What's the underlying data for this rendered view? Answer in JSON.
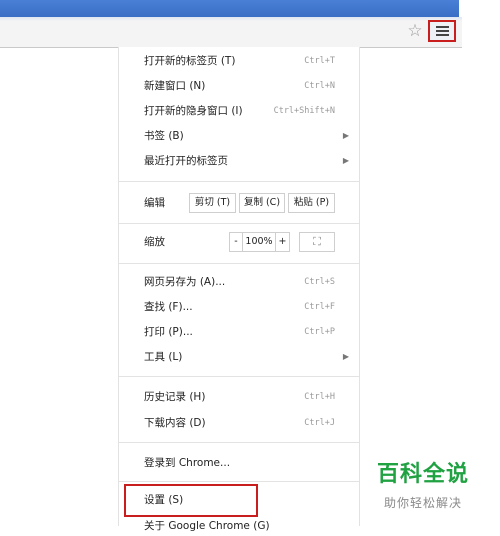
{
  "toolbar": {
    "star_glyph": "☆",
    "star_icon": "star-icon",
    "menu_icon": "menu-icon",
    "highlight_color": "#c81e1e"
  },
  "menu": {
    "new_tab": {
      "label": "打开新的标签页 (T)",
      "shortcut": "Ctrl+T"
    },
    "new_window": {
      "label": "新建窗口 (N)",
      "shortcut": "Ctrl+N"
    },
    "incognito": {
      "label": "打开新的隐身窗口 (I)",
      "shortcut": "Ctrl+Shift+N"
    },
    "bookmarks": {
      "label": "书签 (B)"
    },
    "recent_tabs": {
      "label": "最近打开的标签页"
    },
    "edit": {
      "label": "编辑",
      "cut": "剪切 (T)",
      "copy": "复制 (C)",
      "paste": "粘贴 (P)"
    },
    "zoom": {
      "label": "缩放",
      "minus": "-",
      "level": "100%",
      "plus": "+"
    },
    "save_as": {
      "label": "网页另存为 (A)...",
      "shortcut": "Ctrl+S"
    },
    "find": {
      "label": "查找 (F)...",
      "shortcut": "Ctrl+F"
    },
    "print": {
      "label": "打印 (P)...",
      "shortcut": "Ctrl+P"
    },
    "tools": {
      "label": "工具 (L)"
    },
    "history": {
      "label": "历史记录 (H)",
      "shortcut": "Ctrl+H"
    },
    "downloads": {
      "label": "下载内容 (D)",
      "shortcut": "Ctrl+J"
    },
    "sign_in": {
      "label": "登录到 Chrome..."
    },
    "settings": {
      "label": "设置 (S)"
    },
    "about": {
      "label": "关于 Google Chrome (G)"
    }
  },
  "watermark": {
    "title": "百科全说",
    "subtitle": "助你轻松解决",
    "color": "#20a142"
  }
}
